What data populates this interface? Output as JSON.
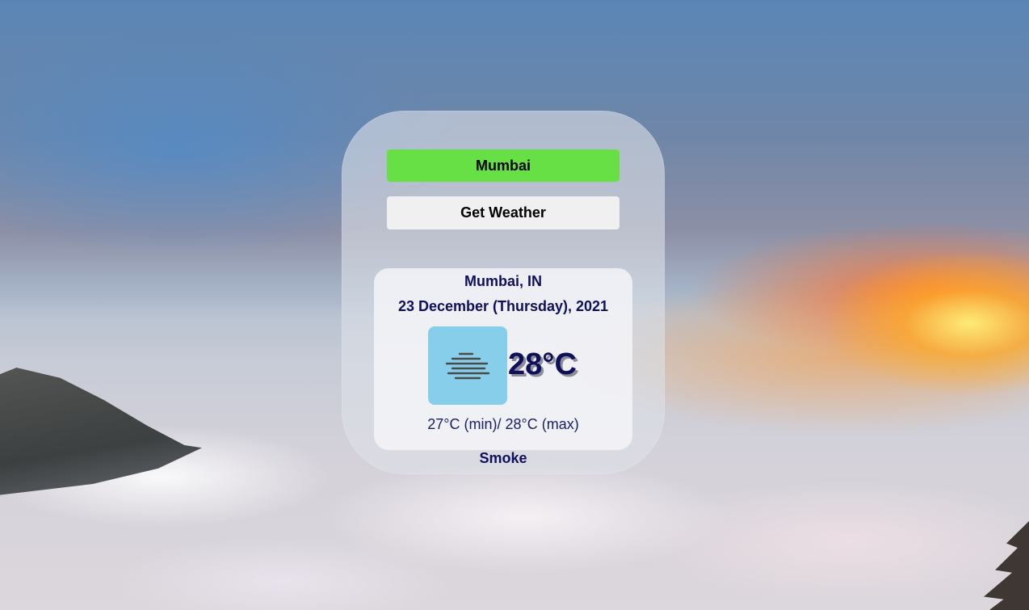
{
  "search": {
    "city_value": "Mumbai",
    "button_label": "Get Weather"
  },
  "weather": {
    "location": "Mumbai, IN",
    "date": "23 December (Thursday), 2021",
    "icon": "haze-lines-icon",
    "temperature": "28°C",
    "min_max": "27°C (min)/ 28°C (max)",
    "condition": "Smoke"
  },
  "colors": {
    "input_bg": "#67e045",
    "icon_bg": "#87ceeb",
    "text_navy": "#0f0f5c"
  }
}
